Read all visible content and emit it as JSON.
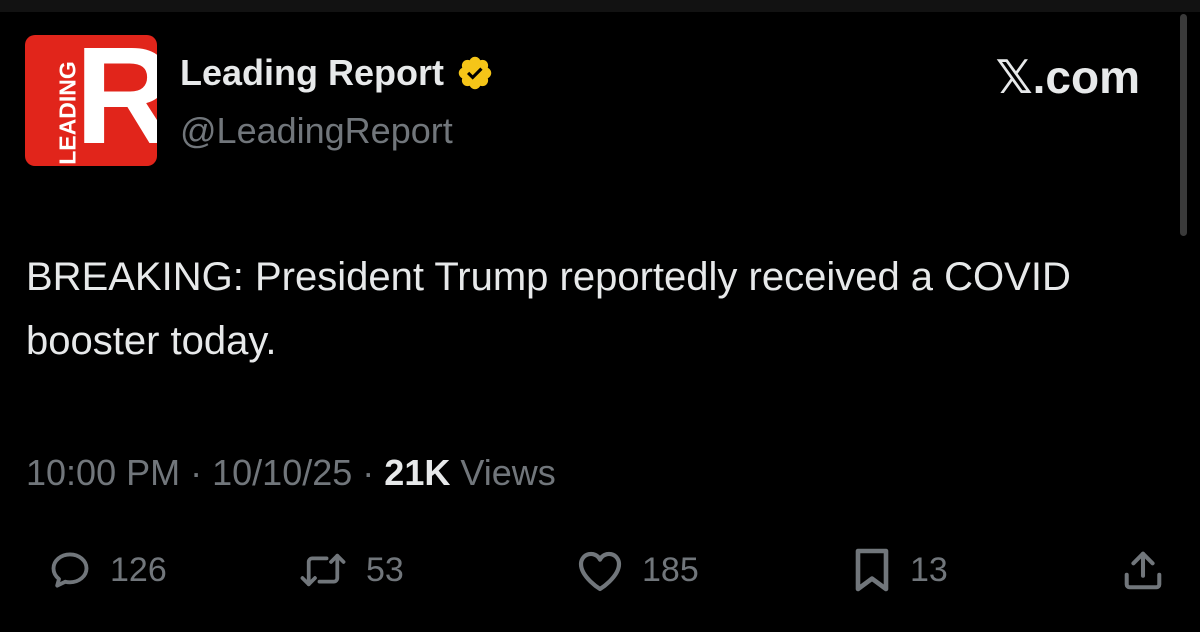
{
  "author": {
    "display_name": "Leading Report",
    "handle": "@LeadingReport",
    "avatar_letter": "R",
    "avatar_side_text": "LEADING",
    "verified_color": "#f5c518"
  },
  "brand": {
    "x_glyph": "𝕏",
    "domain": ".com"
  },
  "tweet": {
    "text": "BREAKING: President Trump reportedly received a COVID booster today.",
    "time": "10:00 PM",
    "separator": "·",
    "date": "10/10/25",
    "views_count": "21K",
    "views_label": "Views"
  },
  "actions": {
    "replies": "126",
    "reposts": "53",
    "likes": "185",
    "bookmarks": "13"
  },
  "colors": {
    "background": "#000000",
    "text": "#e7e9ea",
    "secondary": "#71767b",
    "avatar_red": "#e1251b"
  }
}
